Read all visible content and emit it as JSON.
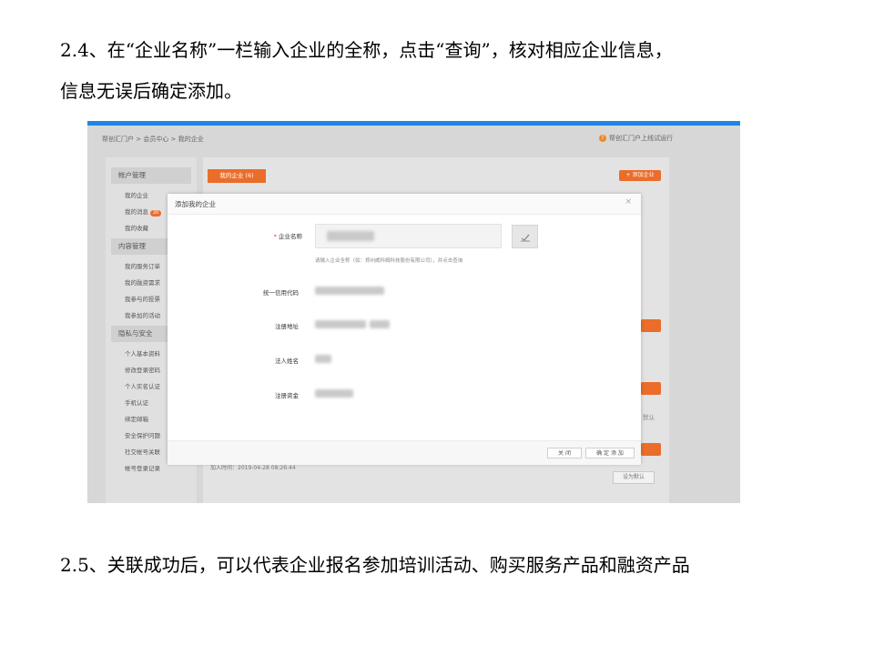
{
  "doc": {
    "step_24_line1": "2.4、在“企业名称”一栏输入企业的全称，点击“查询”，核对相应企业信息，",
    "step_24_line2": "信息无误后确定添加。",
    "step_25": "2.5、关联成功后，可以代表企业报名参加培训活动、购买服务产品和融资产品"
  },
  "screenshot": {
    "breadcrumb": "帮创汇门户 > 会员中心 > 我的企业",
    "notice": "帮创汇门户上线试运行",
    "accent_color": "#ea6d2a",
    "top_bar_color": "#1d86e6",
    "sidebar": {
      "account_header": "帐户管理",
      "account_items": [
        "我的企业",
        "我的消息",
        "我的收藏"
      ],
      "message_badge": "20",
      "content_header": "内容管理",
      "content_items": [
        "我的服务订单",
        "我的融资需求",
        "我参与的投票",
        "我参加的活动"
      ],
      "privacy_header": "隐私与安全",
      "privacy_items": [
        "个人基本资料",
        "修改登录密码",
        "个人实名认证",
        "手机认证",
        "绑定邮箱",
        "安全保护问题",
        "社交帐号关联",
        "帐号登录记录"
      ]
    },
    "main": {
      "tab": "我的企业 (6)",
      "add_button": "+ 添加企业",
      "add_time": "加入时间：2019-04-28 08:26:44",
      "set_default": "设为默认",
      "partial_default": "默认"
    },
    "modal": {
      "title": "添加我的企业",
      "close": "×",
      "required_mark": "*",
      "company_name_label": "企业名称",
      "search_icon": "search-icon",
      "hint": "请输入企业全称（如：郑州威科姆科技股份有限公司），并点击查询",
      "credit_code_label": "统一信用代码",
      "address_label": "注册地址",
      "legal_person_label": "法人姓名",
      "capital_label": "注册资金",
      "btn_close": "关 闭",
      "btn_confirm": "确 定 添 加"
    }
  }
}
